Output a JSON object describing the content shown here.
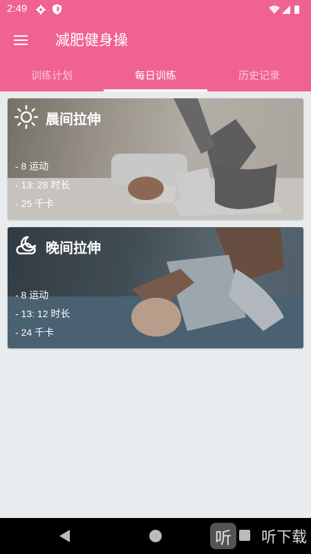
{
  "status_bar": {
    "time": "2:49"
  },
  "app_bar": {
    "title": "减肥健身操"
  },
  "tabs": [
    {
      "label": "训练计划",
      "active": false
    },
    {
      "label": "每日训练",
      "active": true
    },
    {
      "label": "历史记录",
      "active": false
    }
  ],
  "cards": [
    {
      "title": "晨间拉伸",
      "icon": "sun-icon",
      "exercises": "- 8 运动",
      "duration": "- 13: 28 时长",
      "calories": "- 25 千卡"
    },
    {
      "title": "晚间拉伸",
      "icon": "moon-cloud-icon",
      "exercises": "- 8 运动",
      "duration": "- 13: 12 时长",
      "calories": "- 24 千卡"
    }
  ],
  "watermark": {
    "logo_glyph": "听",
    "text": "听下载"
  },
  "colors": {
    "primary": "#f06292",
    "background": "#e8ecef"
  }
}
